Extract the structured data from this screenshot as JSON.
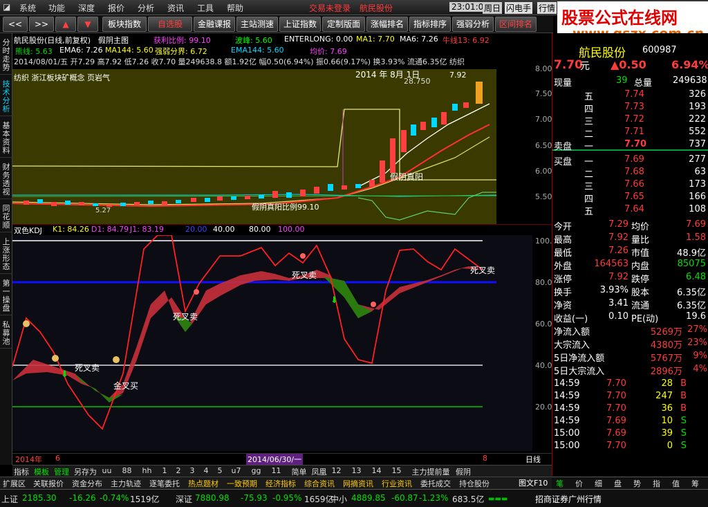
{
  "menu": {
    "items": [
      "系统",
      "功能",
      "深度",
      "报价",
      "分析",
      "资讯",
      "工具",
      "帮助"
    ],
    "status": "交易未登录",
    "stock": "航民股份",
    "time": "23:01:07",
    "weekday": "周日",
    "flash": "闪电手",
    "quote": "行情"
  },
  "brand": {
    "title": "股票公式在线网",
    "url": "www.gszx.com.cn"
  },
  "toolbar": {
    "buttons": [
      "板块指数",
      "自选股",
      "金融课报",
      "主站测速",
      "上证指数",
      "定制版面",
      "涨幅排名",
      "指标排序",
      "强弱分析",
      "区间排名"
    ]
  },
  "side_tabs": [
    "分时走势",
    "技术分析",
    "基本资料",
    "财务透视",
    "同花顺",
    "上涨形态",
    "第一操盘",
    "私募池"
  ],
  "chart": {
    "title": "航民股份(日线,前复权)",
    "indicator": "假阴主图",
    "line1": {
      "a": "获利比例: 99.10",
      "b": "波峰: 5.60",
      "c": "ENTERLONG: 0.00",
      "d": "MA1: 7.70",
      "e": "MA6: 7.26",
      "f": "牛线13: 6.92"
    },
    "line2": {
      "a": "熊线: 5.63",
      "b": "EMA6: 7.26",
      "c": "MA144: 5.60",
      "d": "强弱分界: 6.72",
      "e": "EMA144: 5.60",
      "f": "均价: 7.69"
    },
    "line3": "2014/08/01/五 开7.29 高7.92 低7.26 收7.70 量249638.8 额1.92亿 幅0.50(6.94%) 振0.66(9.17%) 换3.93% 流通6.35亿 纺织",
    "concept": "纺织   浙江板块矿概念 页岩气",
    "date_label": "2014 年 8月 1日",
    "high_label": "7.92",
    "peak_label": "28.750",
    "low_label": "5.27",
    "annot1": "假阴真阳",
    "annot2": "假阴真阳比例99.10",
    "yaxis": [
      "8.00",
      "7.50",
      "7.00",
      "6.50",
      "6.00",
      "5.50"
    ],
    "kdj": {
      "name": "双色KDJ",
      "k": "K1: 84.26",
      "d": "D1: 84.79",
      "j": "J1: 83.19",
      "l1": "20.00",
      "l2": "40.00",
      "l3": "80.00",
      "l4": "100.00"
    },
    "kdj_axis": [
      "100.00",
      "80.00",
      "60.00",
      "40.00",
      "20.00"
    ],
    "kdj_labels": {
      "a": "死叉卖",
      "b": "死叉卖",
      "c": "金叉买",
      "d": "死叉卖",
      "e": "死叉卖"
    },
    "xaxis": {
      "left": "2014年",
      "left2": "6",
      "mid": "2014/06/30/一",
      "right": "8",
      "period": "日线"
    }
  },
  "quote": {
    "name": "航民股份",
    "code": "600987",
    "price": "7.70",
    "unit": "元",
    "change": "▲0.50",
    "pct": "6.94%",
    "now_label": "现量",
    "now_val": "39",
    "total_label": "总量",
    "total_val": "249638",
    "sell": [
      {
        "l": "五",
        "p": "7.74",
        "v": "326"
      },
      {
        "l": "四",
        "p": "7.73",
        "v": "193"
      },
      {
        "l": "三",
        "p": "7.72",
        "v": "222"
      },
      {
        "l": "二",
        "p": "7.71",
        "v": "552"
      },
      {
        "l": "一",
        "p": "7.70",
        "v": "737"
      }
    ],
    "buy": [
      {
        "l": "一",
        "p": "7.69",
        "v": "277"
      },
      {
        "l": "二",
        "p": "7.68",
        "v": "63"
      },
      {
        "l": "三",
        "p": "7.66",
        "v": "173"
      },
      {
        "l": "四",
        "p": "7.65",
        "v": "166"
      },
      {
        "l": "五",
        "p": "7.64",
        "v": "108"
      }
    ],
    "sell_label": "卖盘",
    "buy_label": "买盘",
    "stats": [
      {
        "a": "今开",
        "av": "7.29",
        "b": "均价",
        "bv": "7.69",
        "ac": "red",
        "bc": "red"
      },
      {
        "a": "最高",
        "av": "7.92",
        "b": "量比",
        "bv": "1.58",
        "ac": "red",
        "bc": "red"
      },
      {
        "a": "最低",
        "av": "7.26",
        "b": "市值",
        "bv": "48.9亿",
        "ac": "red",
        "bc": "wht"
      },
      {
        "a": "外盘",
        "av": "164563",
        "b": "内盘",
        "bv": "85075",
        "ac": "red",
        "bc": "grn"
      },
      {
        "a": "涨停",
        "av": "7.92",
        "b": "跌停",
        "bv": "6.48",
        "ac": "red",
        "bc": "grn"
      },
      {
        "a": "换手",
        "av": "3.93%",
        "b": "股本",
        "bv": "6.35亿",
        "ac": "wht",
        "bc": "wht"
      },
      {
        "a": "净资",
        "av": "3.41",
        "b": "流通",
        "bv": "6.35亿",
        "ac": "wht",
        "bc": "wht"
      },
      {
        "a": "收益(一)",
        "av": "0.10",
        "b": "PE(动)",
        "bv": "19.6",
        "ac": "wht",
        "bc": "wht"
      }
    ],
    "flows": [
      {
        "a": "净流入额",
        "v": "5269万",
        "p": "27%"
      },
      {
        "a": "大宗流入",
        "v": "4380万",
        "p": "23%"
      },
      {
        "a": "5日净流入额",
        "v": "5767万",
        "p": "9%"
      },
      {
        "a": "5日大宗流入",
        "v": "2896万",
        "p": "4%"
      }
    ],
    "ticks": [
      {
        "t": "14:59",
        "p": "7.70",
        "v": "28",
        "s": "B"
      },
      {
        "t": "14:59",
        "p": "7.70",
        "v": "247",
        "s": "B"
      },
      {
        "t": "14:59",
        "p": "7.70",
        "v": "36",
        "s": "B"
      },
      {
        "t": "14:59",
        "p": "7.69",
        "v": "10",
        "s": "S"
      },
      {
        "t": "15:00",
        "p": "7.69",
        "v": "39",
        "s": "S"
      },
      {
        "t": "15:00",
        "p": "7.70",
        "v": "0",
        "s": "S"
      }
    ],
    "tabs": [
      "笔",
      "价",
      "细",
      "盘",
      "势",
      "指",
      "值",
      "筹"
    ]
  },
  "bottom_tabs": [
    "指标",
    "模板",
    "管理",
    "另存为",
    "uu",
    "88",
    "hh",
    "1",
    "2",
    "3",
    "4",
    "5",
    "u7",
    "gg",
    "11",
    "简单",
    "凤凰",
    "12",
    "13",
    "14",
    "15",
    "主力提前量",
    "假阴"
  ],
  "bottom_tabs2": [
    "扩展区",
    "关联报价",
    "资金分布",
    "主力轨迹",
    "逐笔委托",
    "热点题材",
    "一致预期",
    "经济指标",
    "综合资讯",
    "网摘资讯",
    "行业资讯",
    "委托成交",
    "持仓股份"
  ],
  "status": {
    "sh_label": "上证",
    "sh": "2185.30",
    "sh_c": "-16.26",
    "sh_p": "-0.74%",
    "sh_a": "1519亿",
    "sz_label": "深证",
    "sz": "7880.98",
    "sz_c": "-75.93",
    "sz_p": "-0.95%",
    "sz_a": "1659亿",
    "zx_label": "中小",
    "zx": "4889.85",
    "zx_c": "-60.87",
    "zx_p": "-1.23%",
    "zx_a": "683.5亿",
    "broker": "招商证券广州行情",
    "fig": "图文F10"
  }
}
